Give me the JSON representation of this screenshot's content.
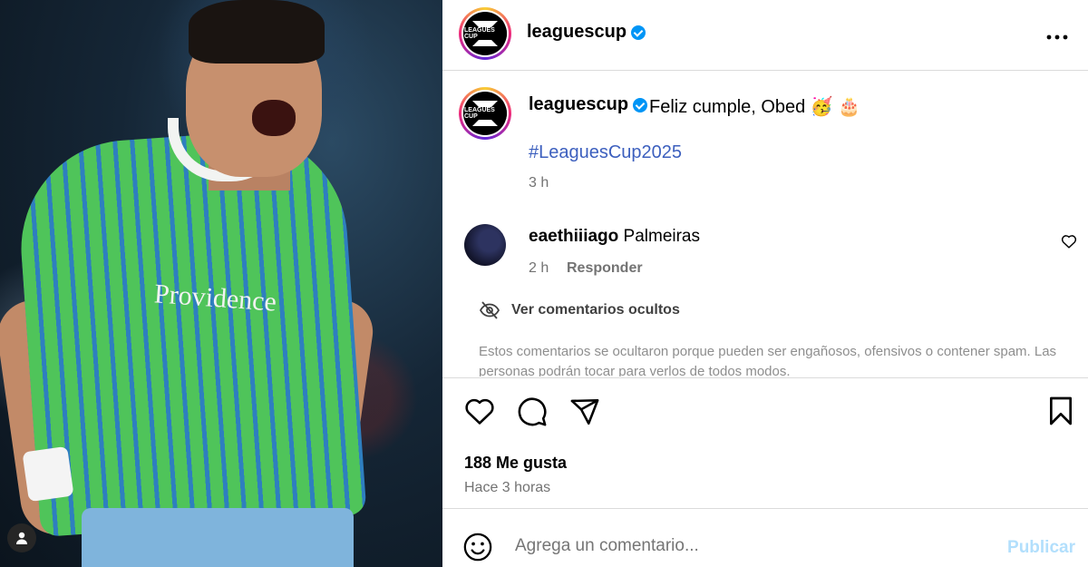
{
  "post": {
    "username": "leaguescup",
    "avatar_text": "LEAGUES CUP",
    "caption": "Feliz cumple, Obed 🥳 🎂",
    "hashtag": "#LeaguesCup2025",
    "time": "3 h",
    "image_sponsor": "Providence",
    "more_icon": "more-horizontal-icon"
  },
  "comment": {
    "username": "eaethiiiago",
    "text": "Palmeiras",
    "time": "2 h",
    "reply_label": "Responder"
  },
  "hidden_comments": {
    "label": "Ver comentarios ocultos",
    "info": "Estos comentarios se ocultaron porque pueden ser engañosos, ofensivos o contener spam. Las personas podrán tocar para verlos de todos modos."
  },
  "stats": {
    "likes": "188 Me gusta",
    "posted": "Hace 3 horas"
  },
  "composer": {
    "placeholder": "Agrega un comentario...",
    "publish_label": "Publicar"
  },
  "colors": {
    "verified": "#0095f6",
    "hashtag": "#3c5fbe",
    "publish_disabled": "#b2dffc",
    "secondary_text": "#737373"
  }
}
